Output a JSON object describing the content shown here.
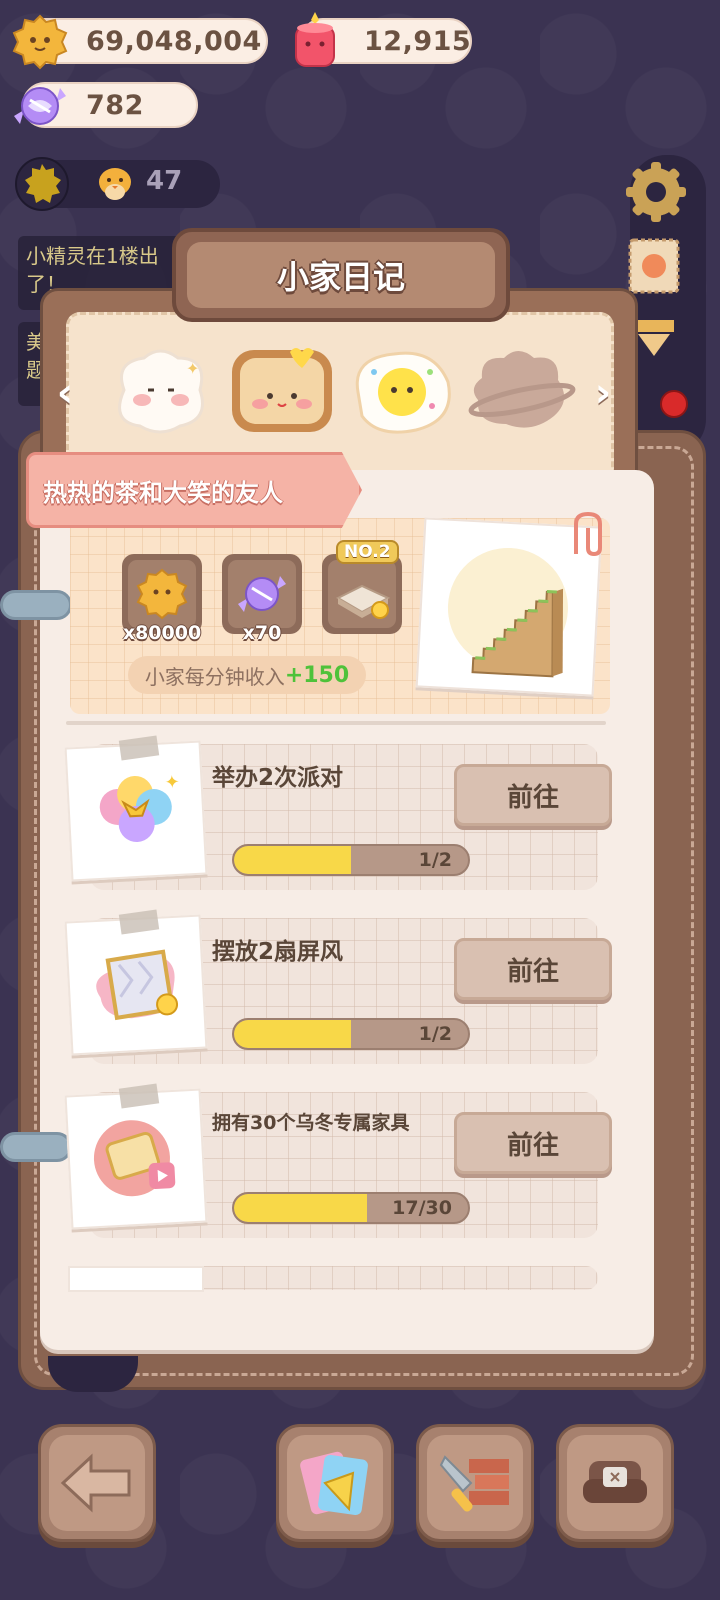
{
  "currencies": {
    "coins": "69,048,004",
    "hearts": "12,915",
    "candy": "782"
  },
  "status": {
    "fairy_count": "47"
  },
  "messages": [
    {
      "text": "小精灵在1楼出了！"
    },
    {
      "text": "美题"
    }
  ],
  "diary": {
    "title": "小家日记",
    "nav_prev": "‹",
    "nav_next": "›",
    "chapter_title": "热热的茶和大笑的友人",
    "rewards": [
      {
        "icon": "cookie-coin-icon",
        "qty": "x80000"
      },
      {
        "icon": "candy-icon",
        "qty": "x70"
      },
      {
        "icon": "floor-tile-icon",
        "badge": "NO.2",
        "qty": ""
      }
    ],
    "income_label": "小家每分钟收入",
    "income_bonus": "+150",
    "tasks": [
      {
        "name": "举办2次派对",
        "button": "前往",
        "progress_text": "1/2",
        "progress": 0.5
      },
      {
        "name": "摆放2扇屏风",
        "button": "前往",
        "progress_text": "1/2",
        "progress": 0.5
      },
      {
        "name": "拥有30个乌冬专属家具",
        "button": "前往",
        "progress_text": "17/30",
        "progress": 0.567
      }
    ]
  },
  "colors": {
    "background": "#3b3352",
    "progress_fill": "#f8d848",
    "bonus_green": "#4fc23a",
    "ribbon_pink": "#f5b3a6"
  },
  "bottom_nav": [
    {
      "icon": "back-arrow-icon"
    },
    {
      "icon": "photo-cards-icon"
    },
    {
      "icon": "build-tools-icon"
    },
    {
      "icon": "sofa-icon"
    }
  ]
}
